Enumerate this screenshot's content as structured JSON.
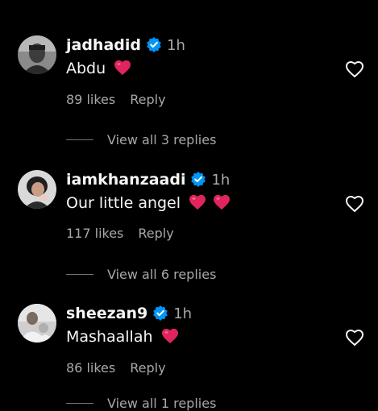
{
  "comments": [
    {
      "username": "jadhadid",
      "verified": true,
      "time": "1h",
      "text": "Abdu",
      "emoji": [
        "red-heart"
      ],
      "likes": "89 likes",
      "reply_label": "Reply",
      "view_replies": "View all 3 replies"
    },
    {
      "username": "iamkhanzaadi",
      "verified": true,
      "time": "1h",
      "text": "Our little angel",
      "emoji": [
        "red-heart",
        "red-heart"
      ],
      "likes": "117 likes",
      "reply_label": "Reply",
      "view_replies": "View all 6 replies"
    },
    {
      "username": "sheezan9",
      "verified": true,
      "time": "1h",
      "text": "Mashaallah",
      "emoji": [
        "red-heart"
      ],
      "likes": "86 likes",
      "reply_label": "Reply",
      "view_replies": "View all 1 replies"
    }
  ],
  "colors": {
    "background": "#000000",
    "primary_text": "#f5f5f5",
    "secondary_text": "#a8a8a8",
    "verified_badge": "#0095f6",
    "heart_emoji": "#e0245e"
  },
  "icons": {
    "verified": "verified-badge-icon",
    "like": "heart-outline-icon",
    "emoji": "red-heart-emoji"
  }
}
